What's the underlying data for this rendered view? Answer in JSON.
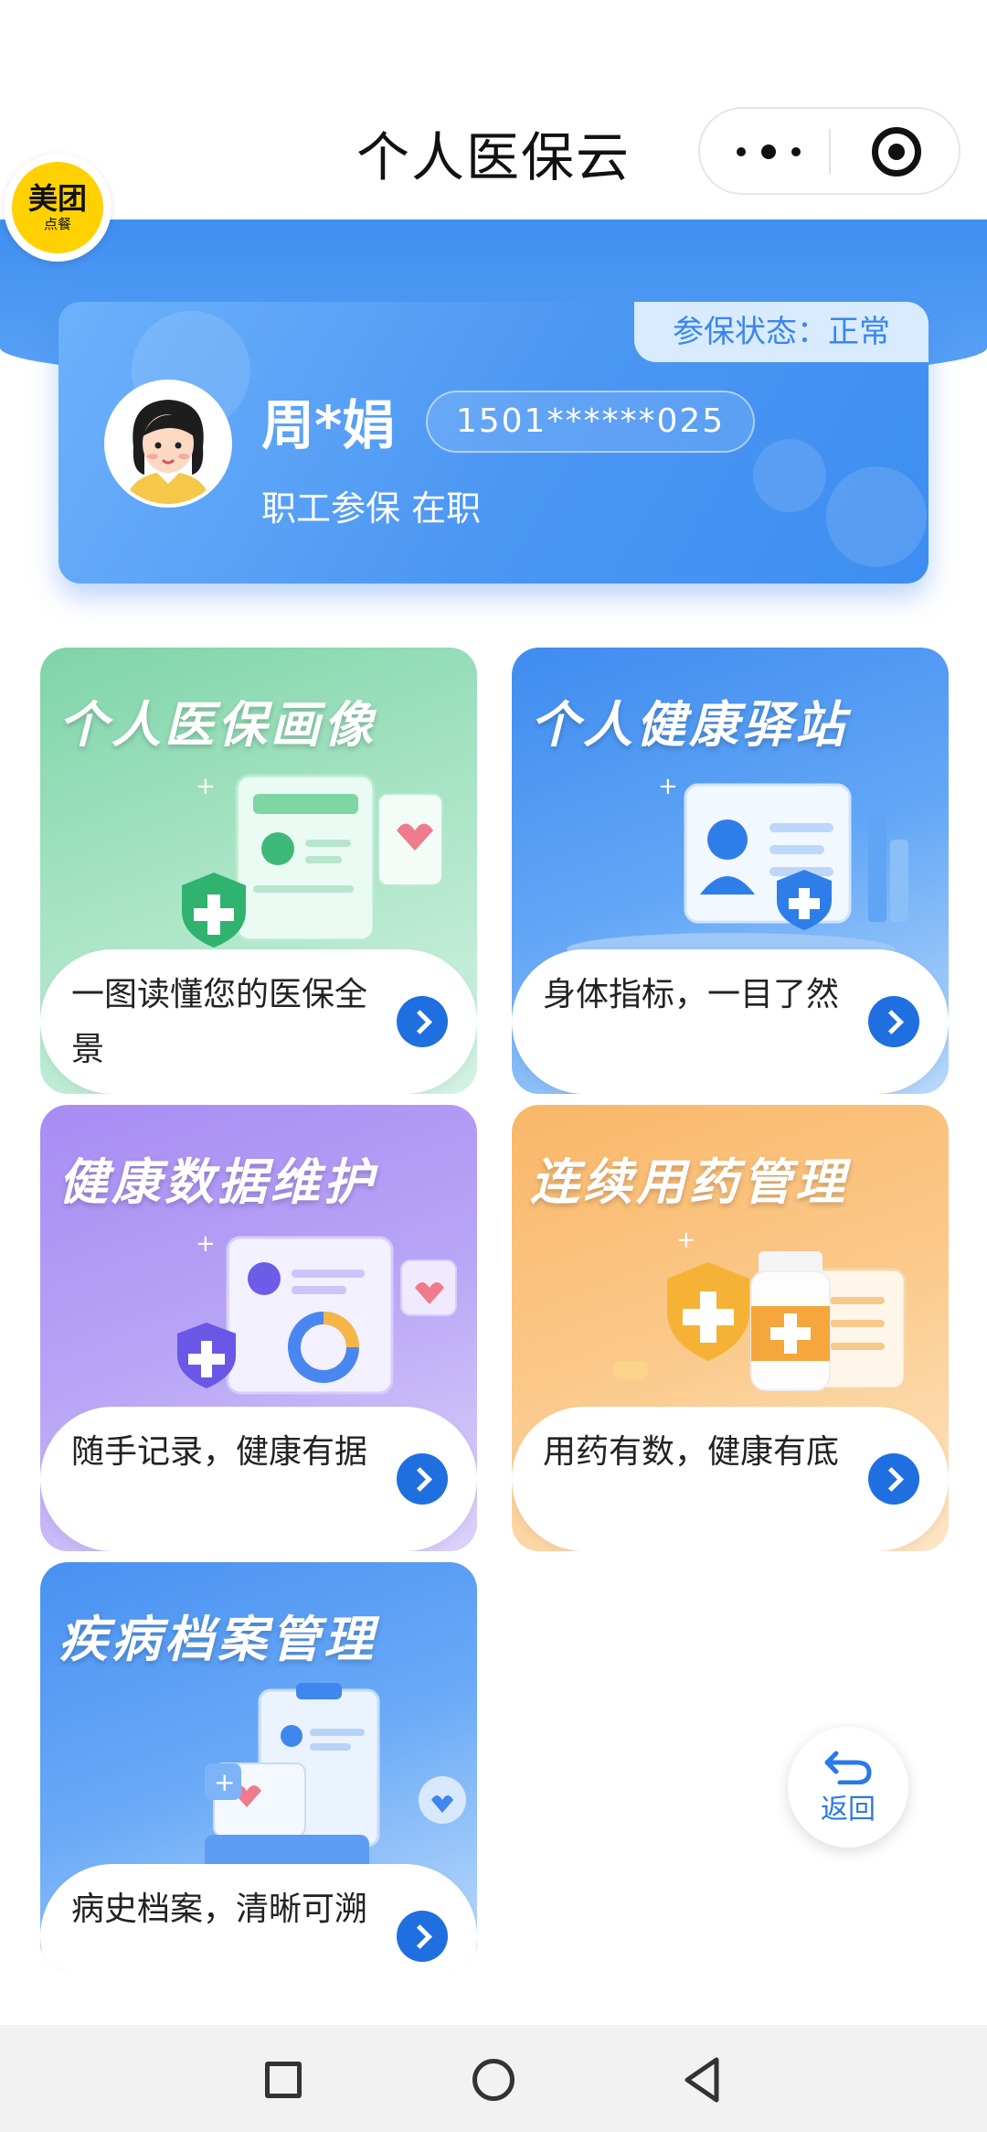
{
  "header": {
    "title": "个人医保云"
  },
  "mini_logo": {
    "big": "美团",
    "small": "点餐"
  },
  "profile": {
    "status": "参保状态：正常",
    "name": "周*娟",
    "phone": "1501******025",
    "type": "职工参保 在职"
  },
  "cards": [
    {
      "title": "个人医保画像",
      "desc": "一图读懂您的医保全景"
    },
    {
      "title": "个人健康驿站",
      "desc": "身体指标，一目了然"
    },
    {
      "title": "健康数据维护",
      "desc": "随手记录，健康有据"
    },
    {
      "title": "连续用药管理",
      "desc": "用药有数，健康有底"
    },
    {
      "title": "疾病档案管理",
      "desc": "病史档案，清晰可溯"
    }
  ],
  "back_button": {
    "label": "返回"
  },
  "colors": {
    "accent": "#1f6fe0",
    "header_blue": "#3f8ff0"
  },
  "icons": [
    "more-icon",
    "target-icon",
    "arrow-right-icon",
    "back-icon",
    "nav-square-icon",
    "nav-circle-icon",
    "nav-back-icon"
  ]
}
